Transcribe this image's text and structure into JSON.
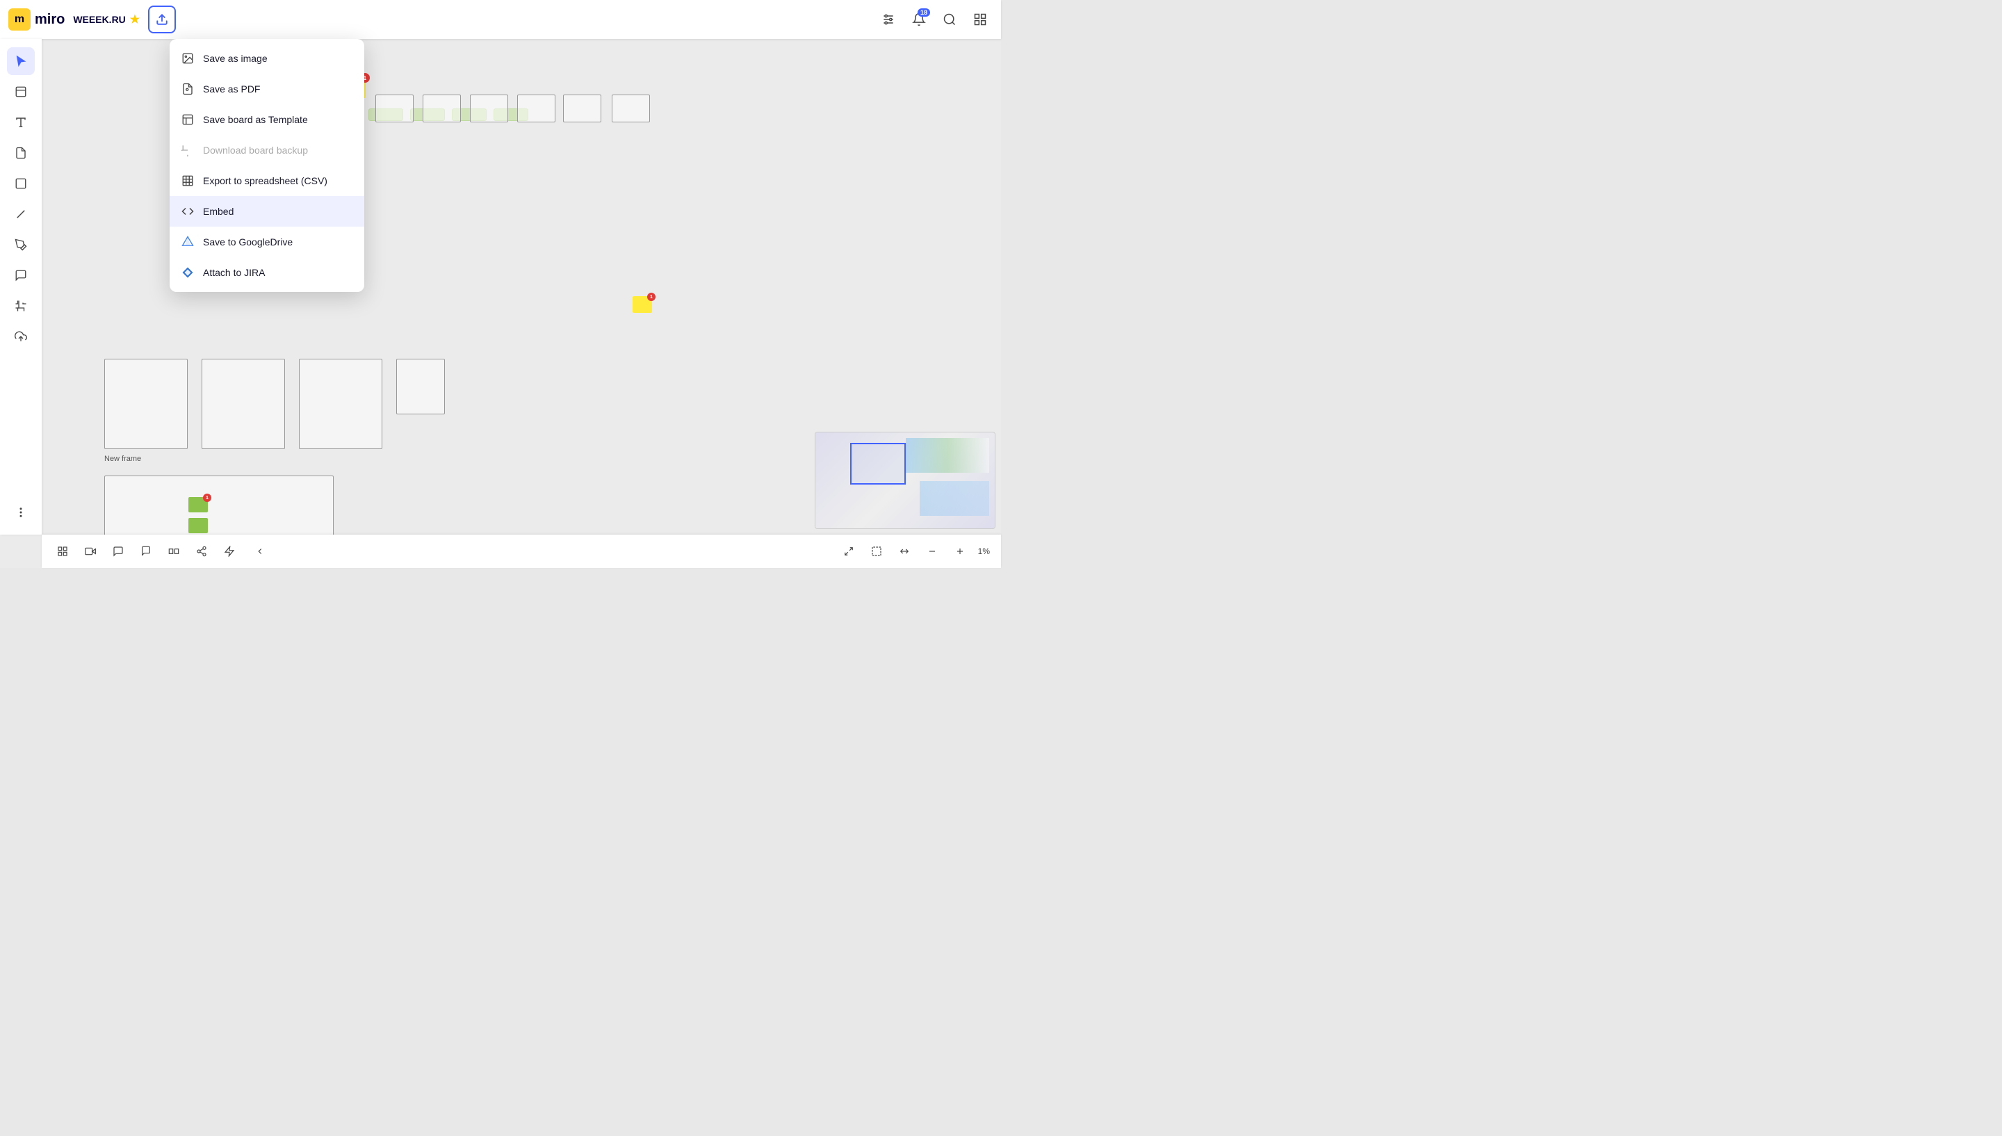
{
  "header": {
    "logo_text": "miro",
    "board_title": "WEEEK.RU",
    "export_tooltip": "Export",
    "notification_count": "18"
  },
  "menu": {
    "items": [
      {
        "id": "save-image",
        "label": "Save as image",
        "icon": "image",
        "disabled": false
      },
      {
        "id": "save-pdf",
        "label": "Save as PDF",
        "icon": "pdf",
        "disabled": false
      },
      {
        "id": "save-template",
        "label": "Save board as Template",
        "icon": "template",
        "disabled": false
      },
      {
        "id": "download-backup",
        "label": "Download board backup",
        "icon": "backup",
        "disabled": true
      },
      {
        "id": "export-csv",
        "label": "Export to spreadsheet (CSV)",
        "icon": "csv",
        "disabled": false
      },
      {
        "id": "embed",
        "label": "Embed",
        "icon": "embed",
        "disabled": false,
        "active": true
      },
      {
        "id": "save-gdrive",
        "label": "Save to GoogleDrive",
        "icon": "gdrive",
        "disabled": false
      },
      {
        "id": "attach-jira",
        "label": "Attach to JIRA",
        "icon": "jira",
        "disabled": false
      }
    ]
  },
  "bottom_toolbar": {
    "tools": [
      "grid",
      "present",
      "comment",
      "chat",
      "frames",
      "share",
      "lightning"
    ],
    "collapse_label": "‹",
    "zoom_level": "1%",
    "fit_label": "Fit",
    "expand_label": "⤢"
  },
  "canvas": {
    "frame_label": "New frame"
  }
}
